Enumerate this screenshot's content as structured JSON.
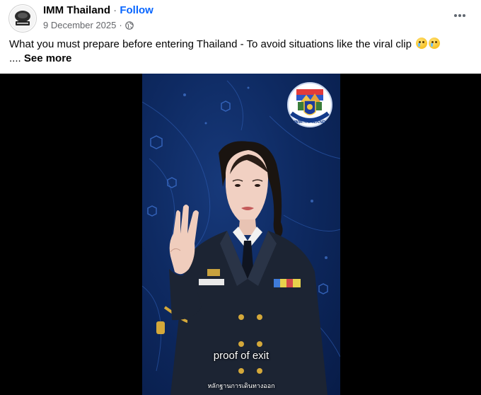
{
  "post": {
    "author": "IMM Thailand",
    "separator": "·",
    "follow_label": "Follow",
    "date": "9 December 2025",
    "meta_separator": "·",
    "caption": "What you must prepare before entering Thailand - To avoid situations like the viral clip",
    "ellipsis": "....",
    "see_more_label": "See more",
    "emojis": [
      "crying-face-emoji",
      "crying-face-emoji"
    ]
  },
  "video": {
    "subtitle_en": "proof of exit",
    "subtitle_th": "หลักฐานการเดินทางออก",
    "logo_text": "IMM.THAILAND"
  },
  "colors": {
    "link": "#0866ff",
    "secondary_text": "#65676b",
    "video_bg": "#0e2a62"
  },
  "icons": {
    "privacy": "globe-icon",
    "menu": "more-horizontal-icon"
  }
}
